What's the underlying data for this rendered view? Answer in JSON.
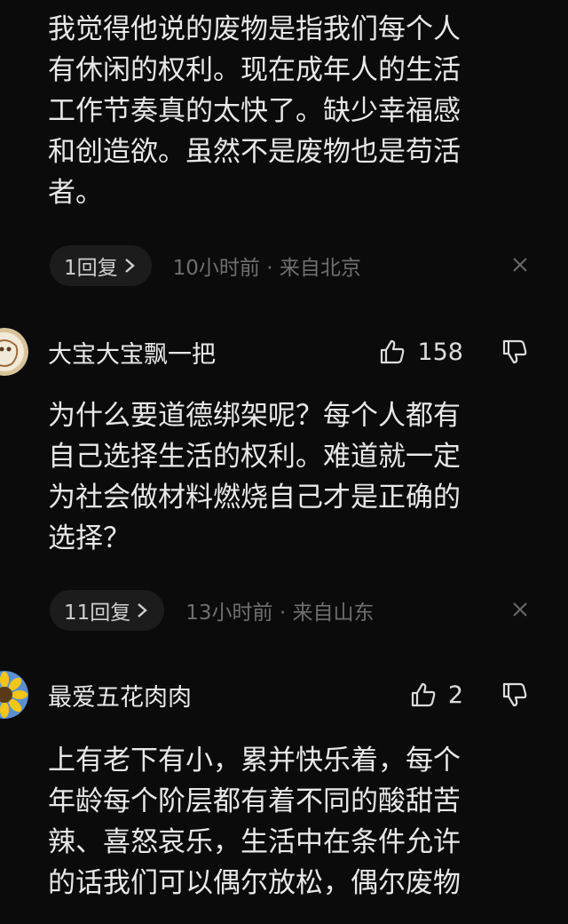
{
  "comments": [
    {
      "body": "我觉得他说的废物是指我们每个人\n有休闲的权利。现在成年人的生活\n工作节奏真的太快了。缺少幸福感\n和创造欲。虽然不是废物也是苟活\n者。",
      "reply_label": "1回复",
      "meta": "10小时前 · 来自北京"
    },
    {
      "username": "大宝大宝飘一把",
      "likes": "158",
      "body": "为什么要道德绑架呢？每个人都有\n自己选择生活的权利。难道就一定\n为社会做材料燃烧自己才是正确的\n选择？",
      "reply_label": "11回复",
      "meta": "13小时前 · 来自山东"
    },
    {
      "username": "最爱五花肉肉",
      "likes": "2",
      "body": "上有老下有小，累并快乐着，每个\n年龄每个阶层都有着不同的酸甜苦\n辣、喜怒哀乐，生活中在条件允许\n的话我们可以偶尔放松，偶尔废物"
    }
  ],
  "icons": {
    "reply_chevron": "chevron-right-icon",
    "close": "close-icon",
    "like": "thumbs-up-icon",
    "dislike": "thumbs-down-icon"
  }
}
